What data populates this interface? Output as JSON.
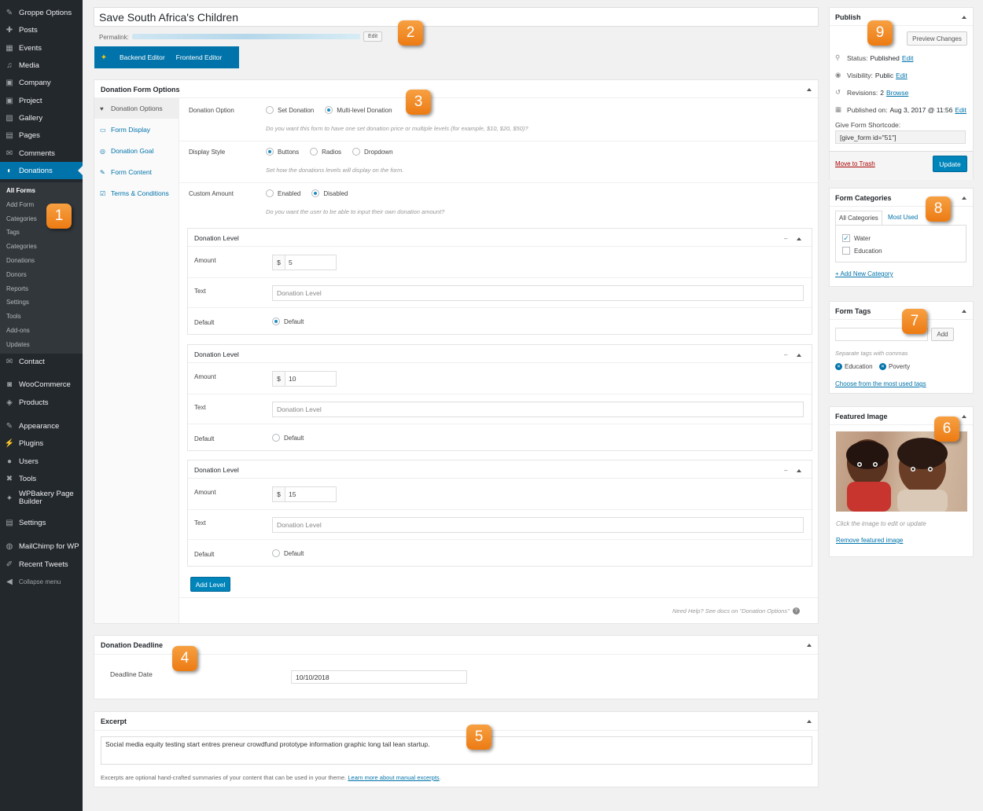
{
  "sidebar": {
    "menu": [
      {
        "label": "Groppe Options",
        "icon": "paint-icon"
      },
      {
        "label": "Posts",
        "icon": "pin-icon"
      },
      {
        "label": "Events",
        "icon": "calendar-icon"
      },
      {
        "label": "Media",
        "icon": "media-icon"
      },
      {
        "label": "Company",
        "icon": "briefcase-icon"
      },
      {
        "label": "Project",
        "icon": "briefcase-icon"
      },
      {
        "label": "Gallery",
        "icon": "image-icon"
      },
      {
        "label": "Pages",
        "icon": "page-icon"
      },
      {
        "label": "Comments",
        "icon": "comment-icon"
      },
      {
        "label": "Donations",
        "icon": "give-icon"
      }
    ],
    "submenu": [
      "All Forms",
      "Add Form",
      "Categories",
      "Tags",
      "Categories",
      "Donations",
      "Donors",
      "Reports",
      "Settings",
      "Tools",
      "Add-ons",
      "Updates"
    ],
    "menu2": [
      {
        "label": "Contact",
        "icon": "mail-icon"
      },
      {
        "label": "WooCommerce",
        "icon": "woo-icon"
      },
      {
        "label": "Products",
        "icon": "box-icon"
      },
      {
        "label": "Appearance",
        "icon": "brush-icon"
      },
      {
        "label": "Plugins",
        "icon": "plug-icon"
      },
      {
        "label": "Users",
        "icon": "user-icon"
      },
      {
        "label": "Tools",
        "icon": "wrench-icon"
      },
      {
        "label": "WPBakery Page Builder",
        "icon": "wpbakery-icon"
      },
      {
        "label": "Settings",
        "icon": "settings-icon"
      },
      {
        "label": "MailChimp for WP",
        "icon": "mailchimp-icon"
      },
      {
        "label": "Recent Tweets",
        "icon": "twitter-icon"
      },
      {
        "label": "Collapse menu",
        "icon": "collapse-icon"
      }
    ]
  },
  "post": {
    "title": "Save South Africa's Children",
    "permalink_label": "Permalink:",
    "permalink_edit": "Edit",
    "backend_editor": "Backend Editor",
    "frontend_editor": "Frontend Editor"
  },
  "donation_options": {
    "title": "Donation Form Options",
    "tabs": [
      "Donation Options",
      "Form Display",
      "Donation Goal",
      "Form Content",
      "Terms & Conditions"
    ],
    "fields": [
      {
        "label": "Donation Option",
        "options": [
          "Set Donation",
          "Multi-level Donation"
        ],
        "selected": 1,
        "desc": "Do you want this form to have one set donation price or multiple levels (for example, $10, $20, $50)?"
      },
      {
        "label": "Display Style",
        "options": [
          "Buttons",
          "Radios",
          "Dropdown"
        ],
        "selected": 0,
        "desc": "Set how the donations levels will display on the form."
      },
      {
        "label": "Custom Amount",
        "options": [
          "Enabled",
          "Disabled"
        ],
        "selected": 1,
        "desc": "Do you want the user to be able to input their own donation amount?"
      }
    ],
    "level_title": "Donation Level",
    "amount_label": "Amount",
    "text_label": "Text",
    "default_label": "Default",
    "currency": "$",
    "text_placeholder": "Donation Level",
    "default_option": "Default",
    "levels": [
      {
        "amount": "5",
        "is_default": true
      },
      {
        "amount": "10",
        "is_default": false
      },
      {
        "amount": "15",
        "is_default": false
      }
    ],
    "add_level": "Add Level",
    "help": "Need Help? See docs on \"Donation Options\""
  },
  "deadline": {
    "title": "Donation Deadline",
    "label": "Deadline Date",
    "value": "10/10/2018"
  },
  "excerpt": {
    "title": "Excerpt",
    "value": "Social media equity testing start entres preneur crowdfund prototype information graphic long tail lean startup.",
    "note": "Excerpts are optional hand-crafted summaries of your content that can be used in your theme.",
    "link": "Learn more about manual excerpts"
  },
  "publish": {
    "title": "Publish",
    "preview": "Preview Changes",
    "status_label": "Status:",
    "status_value": "Published",
    "visibility_label": "Visibility:",
    "visibility_value": "Public",
    "revisions_label": "Revisions:",
    "revisions_value": "2",
    "browse": "Browse",
    "published_label": "Published on:",
    "published_value": "Aug 3, 2017 @ 11:56",
    "edit": "Edit",
    "shortcode_label": "Give Form Shortcode:",
    "shortcode": "[give_form id=\"51\"]",
    "trash": "Move to Trash",
    "update": "Update"
  },
  "categories": {
    "title": "Form Categories",
    "tab_all": "All Categories",
    "tab_used": "Most Used",
    "items": [
      {
        "label": "Water",
        "checked": true
      },
      {
        "label": "Education",
        "checked": false
      }
    ],
    "add_new": "+ Add New Category"
  },
  "tags": {
    "title": "Form Tags",
    "add": "Add",
    "hint": "Separate tags with commas",
    "items": [
      "Education",
      "Poverty"
    ],
    "choose": "Choose from the most used tags"
  },
  "featured": {
    "title": "Featured Image",
    "hint": "Click the image to edit or update",
    "remove": "Remove featured image"
  },
  "badges": [
    "1",
    "2",
    "3",
    "4",
    "5",
    "6",
    "7",
    "8",
    "9"
  ],
  "colors": {
    "accent": "#0073aa",
    "sidebar": "#23282d",
    "badge": "#ef7f1a"
  }
}
